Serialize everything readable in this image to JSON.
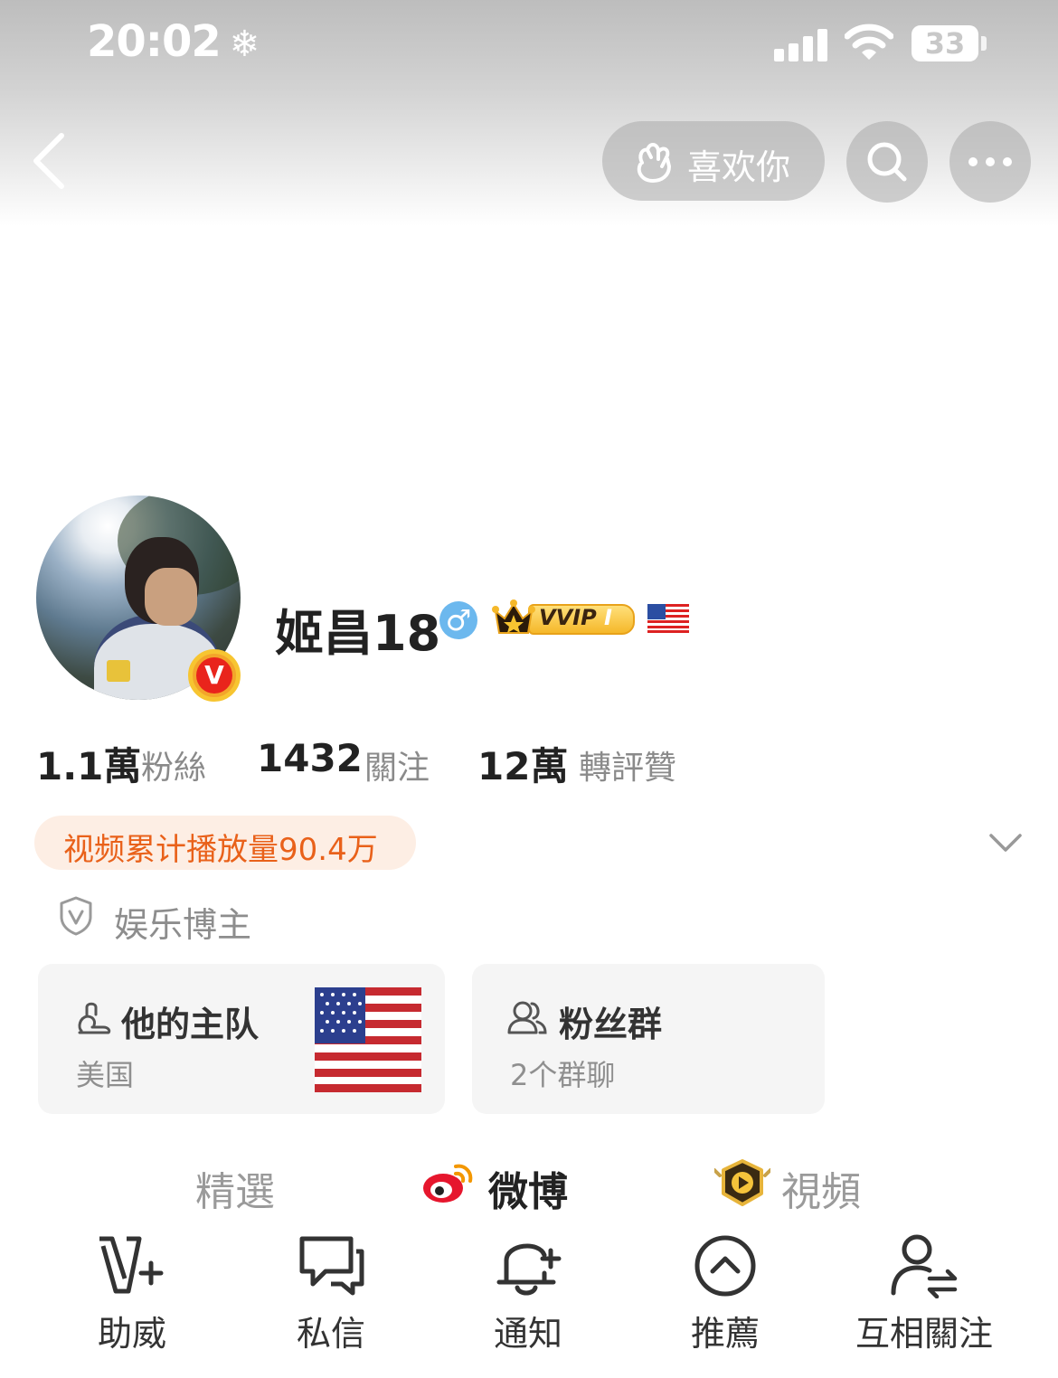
{
  "status_bar": {
    "time": "20:02",
    "weather_icon": "snowflake-icon",
    "battery": "33"
  },
  "header": {
    "like_label": "喜欢你",
    "icons": [
      "back-icon",
      "like-hand-icon",
      "search-icon",
      "more-icon"
    ]
  },
  "profile": {
    "name": "姬昌18",
    "gender": "male",
    "gender_symbol": "♂",
    "vvip_label": "VVIP",
    "vvip_level": "I",
    "verified_badge": "V",
    "stats": [
      {
        "value": "1.1萬",
        "label": "粉絲"
      },
      {
        "value": "1432",
        "label": "關注"
      },
      {
        "value": "12萬",
        "label": "轉評贊"
      }
    ],
    "video_plays": "视频累计播放量90.4万",
    "blogger_type": "娱乐博主"
  },
  "cards": {
    "team": {
      "title": "他的主队",
      "subtitle": "美国"
    },
    "fans": {
      "title": "粉丝群",
      "subtitle": "2个群聊"
    }
  },
  "tabs": [
    {
      "label": "精選",
      "active": false
    },
    {
      "label": "微博",
      "active": true
    },
    {
      "label": "視頻",
      "active": false
    }
  ],
  "actions": [
    {
      "label": "助威",
      "icon": "cheer-v-plus-icon"
    },
    {
      "label": "私信",
      "icon": "message-icon"
    },
    {
      "label": "通知",
      "icon": "bell-plus-icon"
    },
    {
      "label": "推薦",
      "icon": "recommend-up-icon"
    },
    {
      "label": "互相關注",
      "icon": "mutual-follow-icon"
    }
  ],
  "colors": {
    "accent_orange": "#e9611a",
    "pill_bg": "#fdeee4",
    "card_bg": "#f5f5f5",
    "gender_blue": "#6cb8ee"
  }
}
